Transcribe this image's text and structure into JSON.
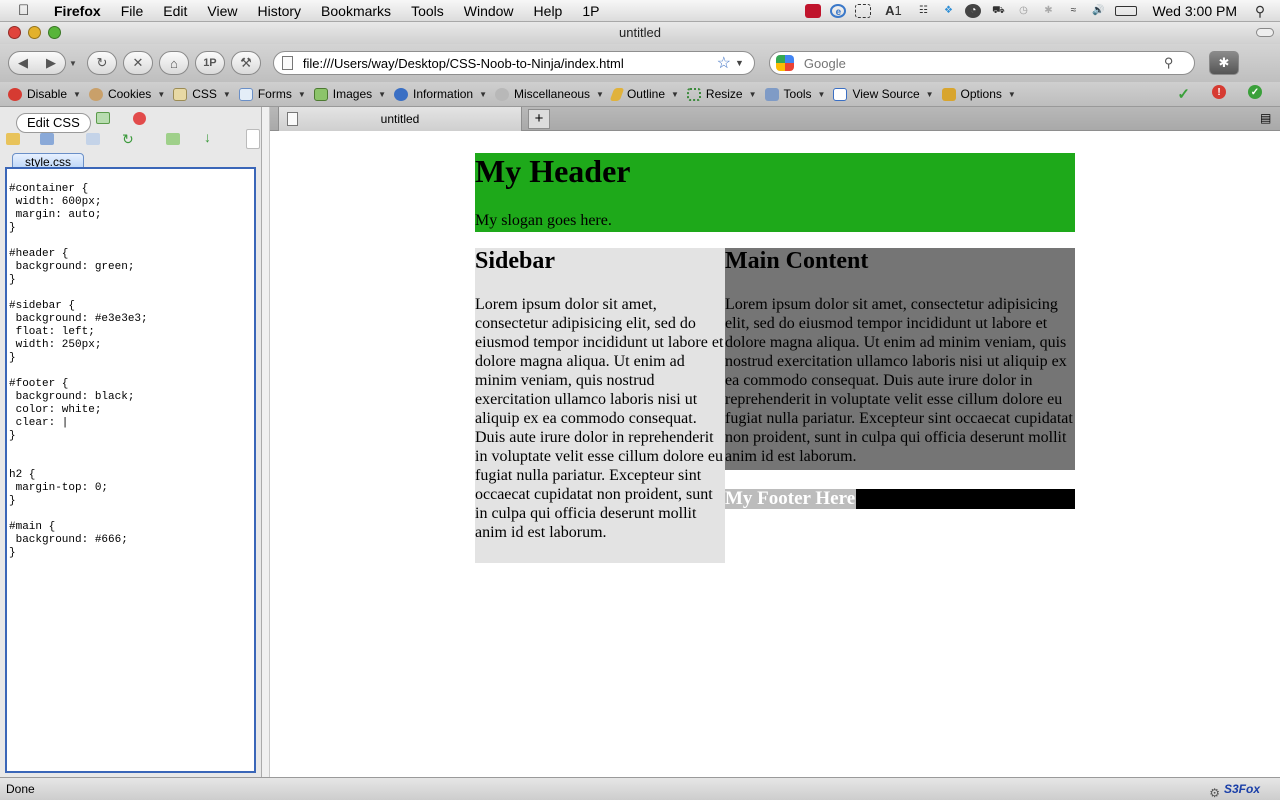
{
  "menubar": {
    "app": "Firefox",
    "items": [
      "File",
      "Edit",
      "View",
      "History",
      "Bookmarks",
      "Tools",
      "Window",
      "Help",
      "1P"
    ],
    "tray_text": "1",
    "clock": "Wed 3:00 PM"
  },
  "window": {
    "title": "untitled"
  },
  "nav": {
    "url": "file:///Users/way/Desktop/CSS-Noob-to-Ninja/index.html",
    "search_placeholder": "Google",
    "onepass_label": "1P"
  },
  "devtoolbar": {
    "items": [
      "Disable",
      "Cookies",
      "CSS",
      "Forms",
      "Images",
      "Information",
      "Miscellaneous",
      "Outline",
      "Resize",
      "Tools",
      "View Source",
      "Options"
    ]
  },
  "sidepanel": {
    "title": "Edit CSS",
    "file_tab": "style.css",
    "css_text": "#container {\n width: 600px;\n margin: auto;\n}\n\n#header {\n background: green;\n}\n\n#sidebar {\n background: #e3e3e3;\n float: left;\n width: 250px;\n}\n\n#footer {\n background: black;\n color: white;\n clear: |\n}\n\n\nh2 {\n margin-top: 0;\n}\n\n#main {\n background: #666;\n}"
  },
  "tabs": [
    {
      "label": "untitled"
    }
  ],
  "newtab_label": "+",
  "page": {
    "header_title": "My Header",
    "slogan": "My slogan goes here.",
    "sidebar_title": "Sidebar",
    "sidebar_text": "Lorem ipsum dolor sit amet, consectetur adipisicing elit, sed do eiusmod tempor incididunt ut labore et dolore magna aliqua. Ut enim ad minim veniam, quis nostrud exercitation ullamco laboris nisi ut aliquip ex ea commodo consequat. Duis aute irure dolor in reprehenderit in voluptate velit esse cillum dolore eu fugiat nulla pariatur. Excepteur sint occaecat cupidatat non proident, sunt in culpa qui officia deserunt mollit anim id est laborum.",
    "main_title": "Main Content",
    "main_text": "Lorem ipsum dolor sit amet, consectetur adipisicing elit, sed do eiusmod tempor incididunt ut labore et dolore magna aliqua. Ut enim ad minim veniam, quis nostrud exercitation ullamco laboris nisi ut aliquip ex ea commodo consequat. Duis aute irure dolor in reprehenderit in voluptate velit esse cillum dolore eu fugiat nulla pariatur. Excepteur sint occaecat cupidatat non proident, sunt in culpa qui officia deserunt mollit anim id est laborum.",
    "footer_title": "My Footer Here"
  },
  "colors": {
    "header_bg": "#1ea91a",
    "sidebar_bg": "#e3e3e3",
    "main_bg": "#757575",
    "footer_bg": "#000000"
  },
  "status": {
    "text": "Done",
    "addon": "S3Fox"
  }
}
